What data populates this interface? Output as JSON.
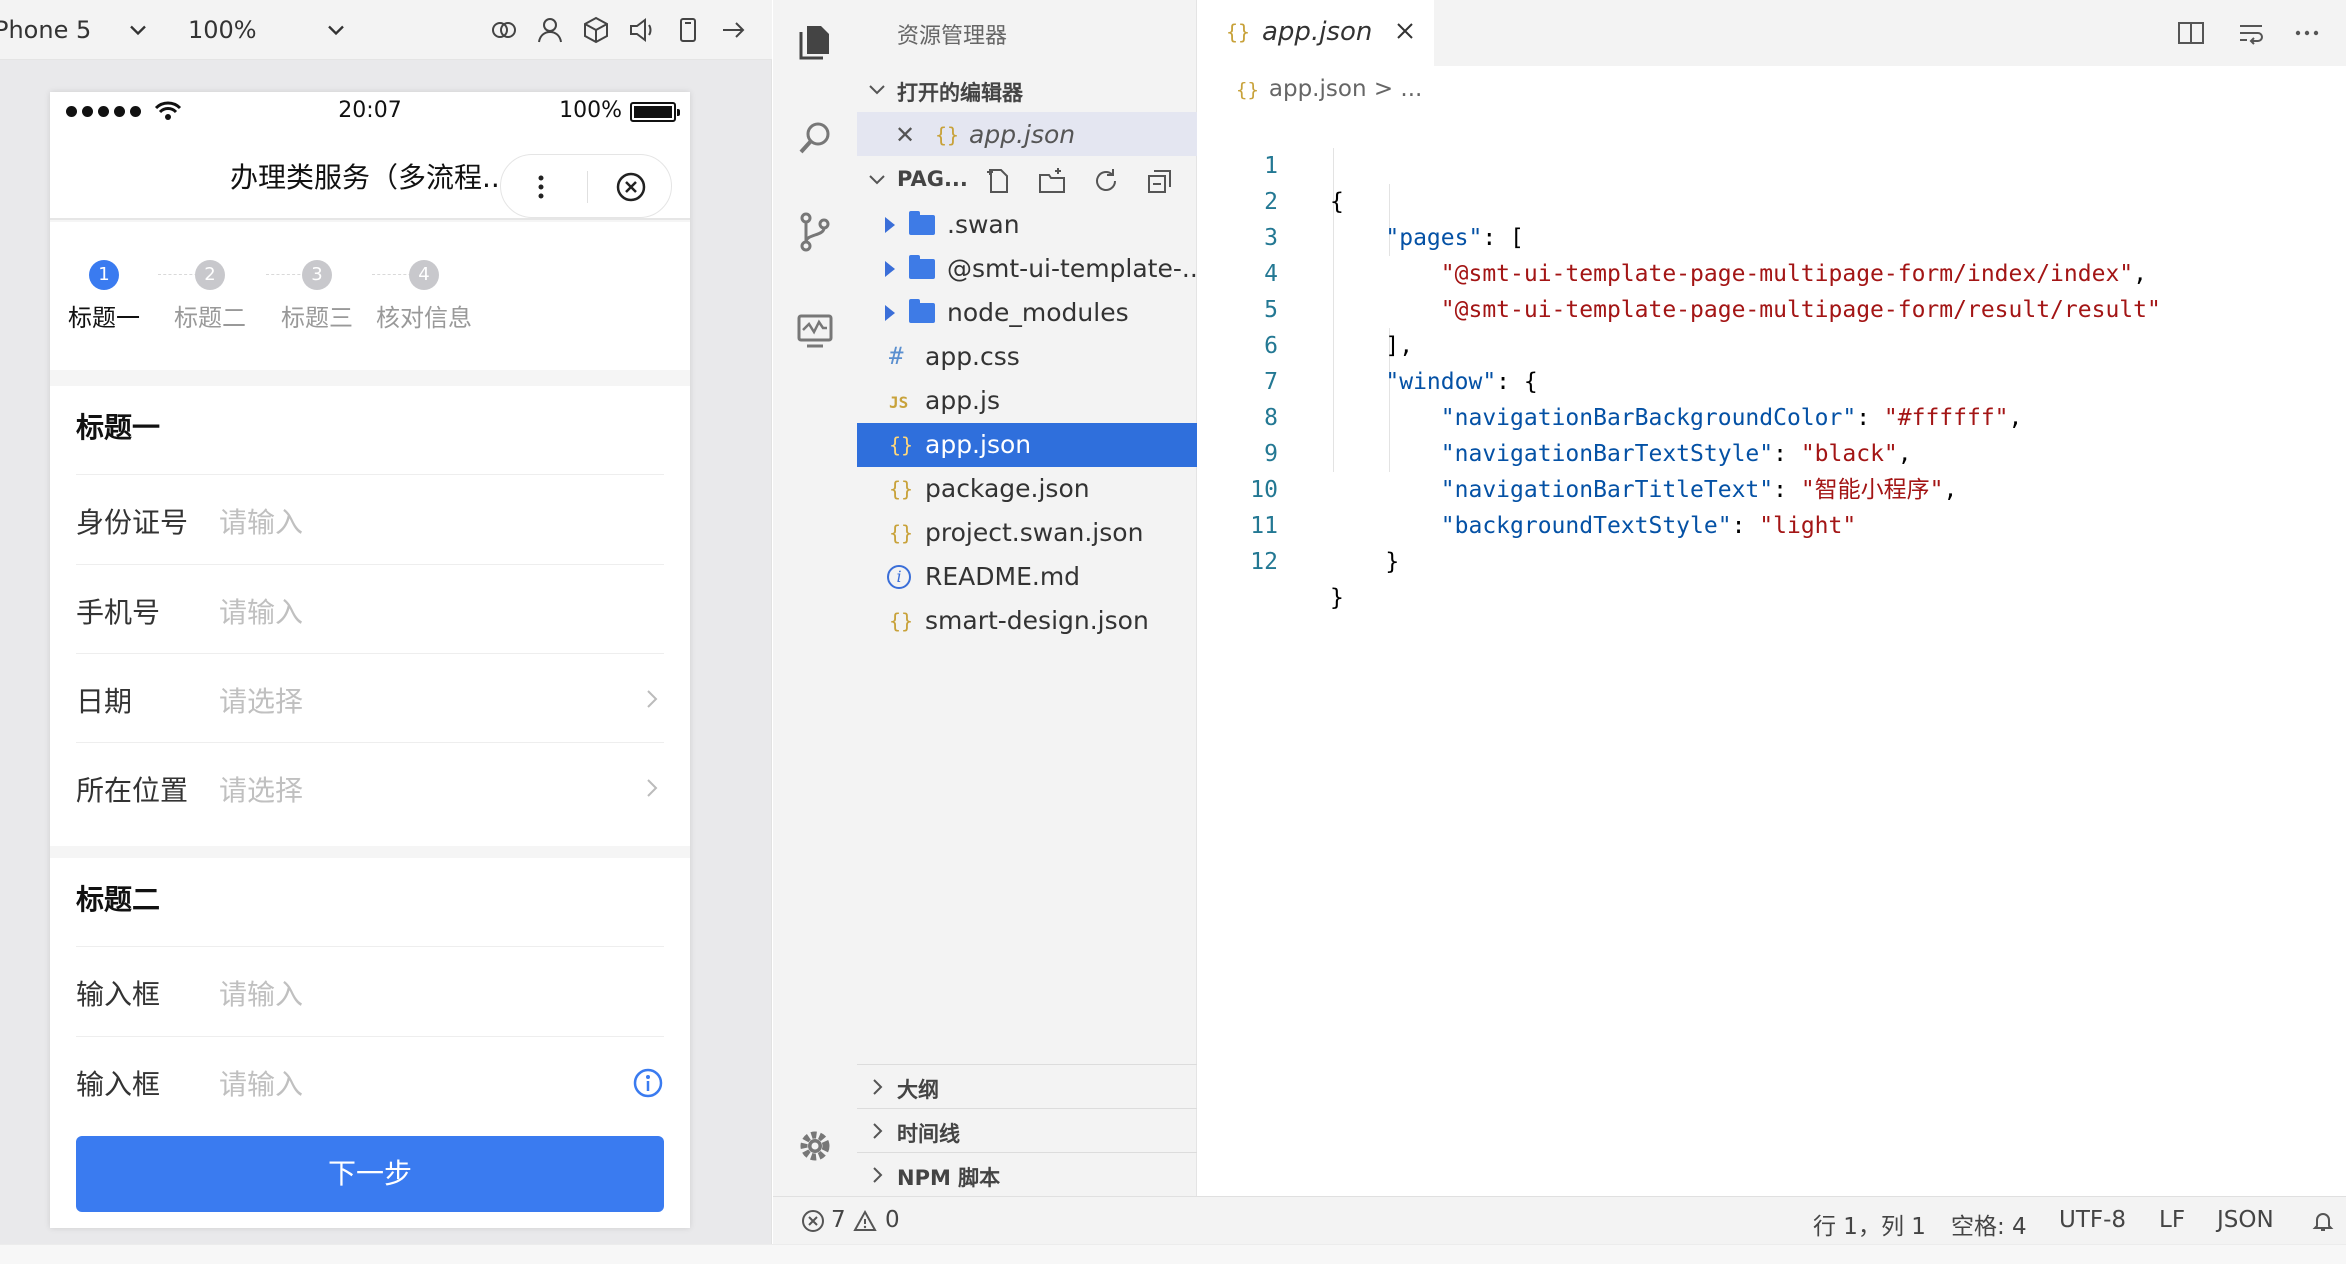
{
  "simulator": {
    "device": "Phone 5",
    "zoom": "100%",
    "icons": [
      "rings-icon",
      "user-icon",
      "cube-icon",
      "speaker-icon",
      "rotate-icon",
      "arrow-right-icon"
    ]
  },
  "phone": {
    "status": {
      "time": "20:07",
      "battery": "100%"
    },
    "nav_title": "办理类服务（多流程...",
    "steps": [
      {
        "num": "1",
        "label": "标题一"
      },
      {
        "num": "2",
        "label": "标题二"
      },
      {
        "num": "3",
        "label": "标题三"
      },
      {
        "num": "4",
        "label": "核对信息"
      }
    ],
    "group1": {
      "title": "标题一",
      "rows": [
        {
          "label": "身份证号",
          "placeholder": "请输入"
        },
        {
          "label": "手机号",
          "placeholder": "请输入"
        },
        {
          "label": "日期",
          "placeholder": "请选择"
        },
        {
          "label": "所在位置",
          "placeholder": "请选择"
        }
      ]
    },
    "group2": {
      "title": "标题二",
      "rows": [
        {
          "label": "输入框",
          "placeholder": "请输入"
        },
        {
          "label": "输入框",
          "placeholder": "请输入"
        }
      ]
    },
    "next_button": "下一步"
  },
  "explorer": {
    "header": "资源管理器",
    "open_editors_label": "打开的编辑器",
    "open_file": "app.json",
    "project_label": "PAG...",
    "tree": [
      {
        "name": ".swan",
        "type": "folder"
      },
      {
        "name": "@smt-ui-template-...",
        "type": "folder"
      },
      {
        "name": "node_modules",
        "type": "folder"
      },
      {
        "name": "app.css",
        "type": "css"
      },
      {
        "name": "app.js",
        "type": "js"
      },
      {
        "name": "app.json",
        "type": "json"
      },
      {
        "name": "package.json",
        "type": "json"
      },
      {
        "name": "project.swan.json",
        "type": "json"
      },
      {
        "name": "README.md",
        "type": "info"
      },
      {
        "name": "smart-design.json",
        "type": "json"
      }
    ],
    "outline_label": "大纲",
    "timeline_label": "时间线",
    "npm_label": "NPM 脚本"
  },
  "editor": {
    "tab_name": "app.json",
    "breadcrumb_file": "app.json",
    "breadcrumb_rest": "> ...",
    "code": {
      "l1": "{",
      "l2_key": "\"pages\"",
      "l2_rest": ": [",
      "l3": "\"@smt-ui-template-page-multipage-form/index/index\"",
      "l4": "\"@smt-ui-template-page-multipage-form/result/result\"",
      "l5": "],",
      "l6_key": "\"window\"",
      "l6_rest": ": {",
      "l7_key": "\"navigationBarBackgroundColor\"",
      "l7_val": "\"#ffffff\"",
      "l8_key": "\"navigationBarTextStyle\"",
      "l8_val": "\"black\"",
      "l9_key": "\"navigationBarTitleText\"",
      "l9_val": "\"智能小程序\"",
      "l10_key": "\"backgroundTextStyle\"",
      "l10_val": "\"light\"",
      "l11": "}",
      "l12": "}"
    },
    "line_numbers": [
      "1",
      "2",
      "3",
      "4",
      "5",
      "6",
      "7",
      "8",
      "9",
      "10",
      "11",
      "12"
    ]
  },
  "statusbar": {
    "errors": "7",
    "warnings": "0",
    "position": "行 1，列 1",
    "spaces": "空格: 4",
    "encoding": "UTF-8",
    "eol": "LF",
    "language": "JSON"
  }
}
